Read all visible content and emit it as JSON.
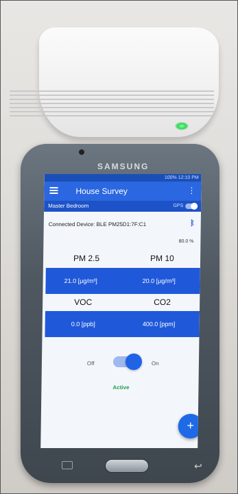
{
  "device": {
    "brand": "SAMSUNG"
  },
  "phone": {
    "status_text": "100% 12:10 PM"
  },
  "app": {
    "title": "House Survey",
    "room": "Master Bedroom",
    "gps_label": "GPS",
    "gps_enabled": true,
    "connected_device": "Connected Device:  BLE PM25D1:7F:C1",
    "battery": "80.0 %"
  },
  "metrics": {
    "pm25_label": "PM 2.5",
    "pm10_label": "PM 10",
    "pm25_value": "21.0 [μg/m³]",
    "pm10_value": "20.0 [μg/m³]",
    "voc_label": "VOC",
    "co2_label": "CO2",
    "voc_value": "0.0 [ppb]",
    "co2_value": "400.0 [ppm]"
  },
  "control": {
    "off_label": "Off",
    "on_label": "On",
    "toggle_on": true,
    "status": "Active"
  },
  "fab": {
    "icon": "+"
  },
  "icons": {
    "menu": "menu-icon",
    "overflow": "overflow-icon",
    "bluetooth": "bluetooth-icon",
    "add": "add-icon"
  },
  "colors": {
    "app_blue": "#2a67e0",
    "panel_blue": "#1f58d9",
    "active_green": "#21a04a",
    "led_green": "#2fd45a"
  }
}
